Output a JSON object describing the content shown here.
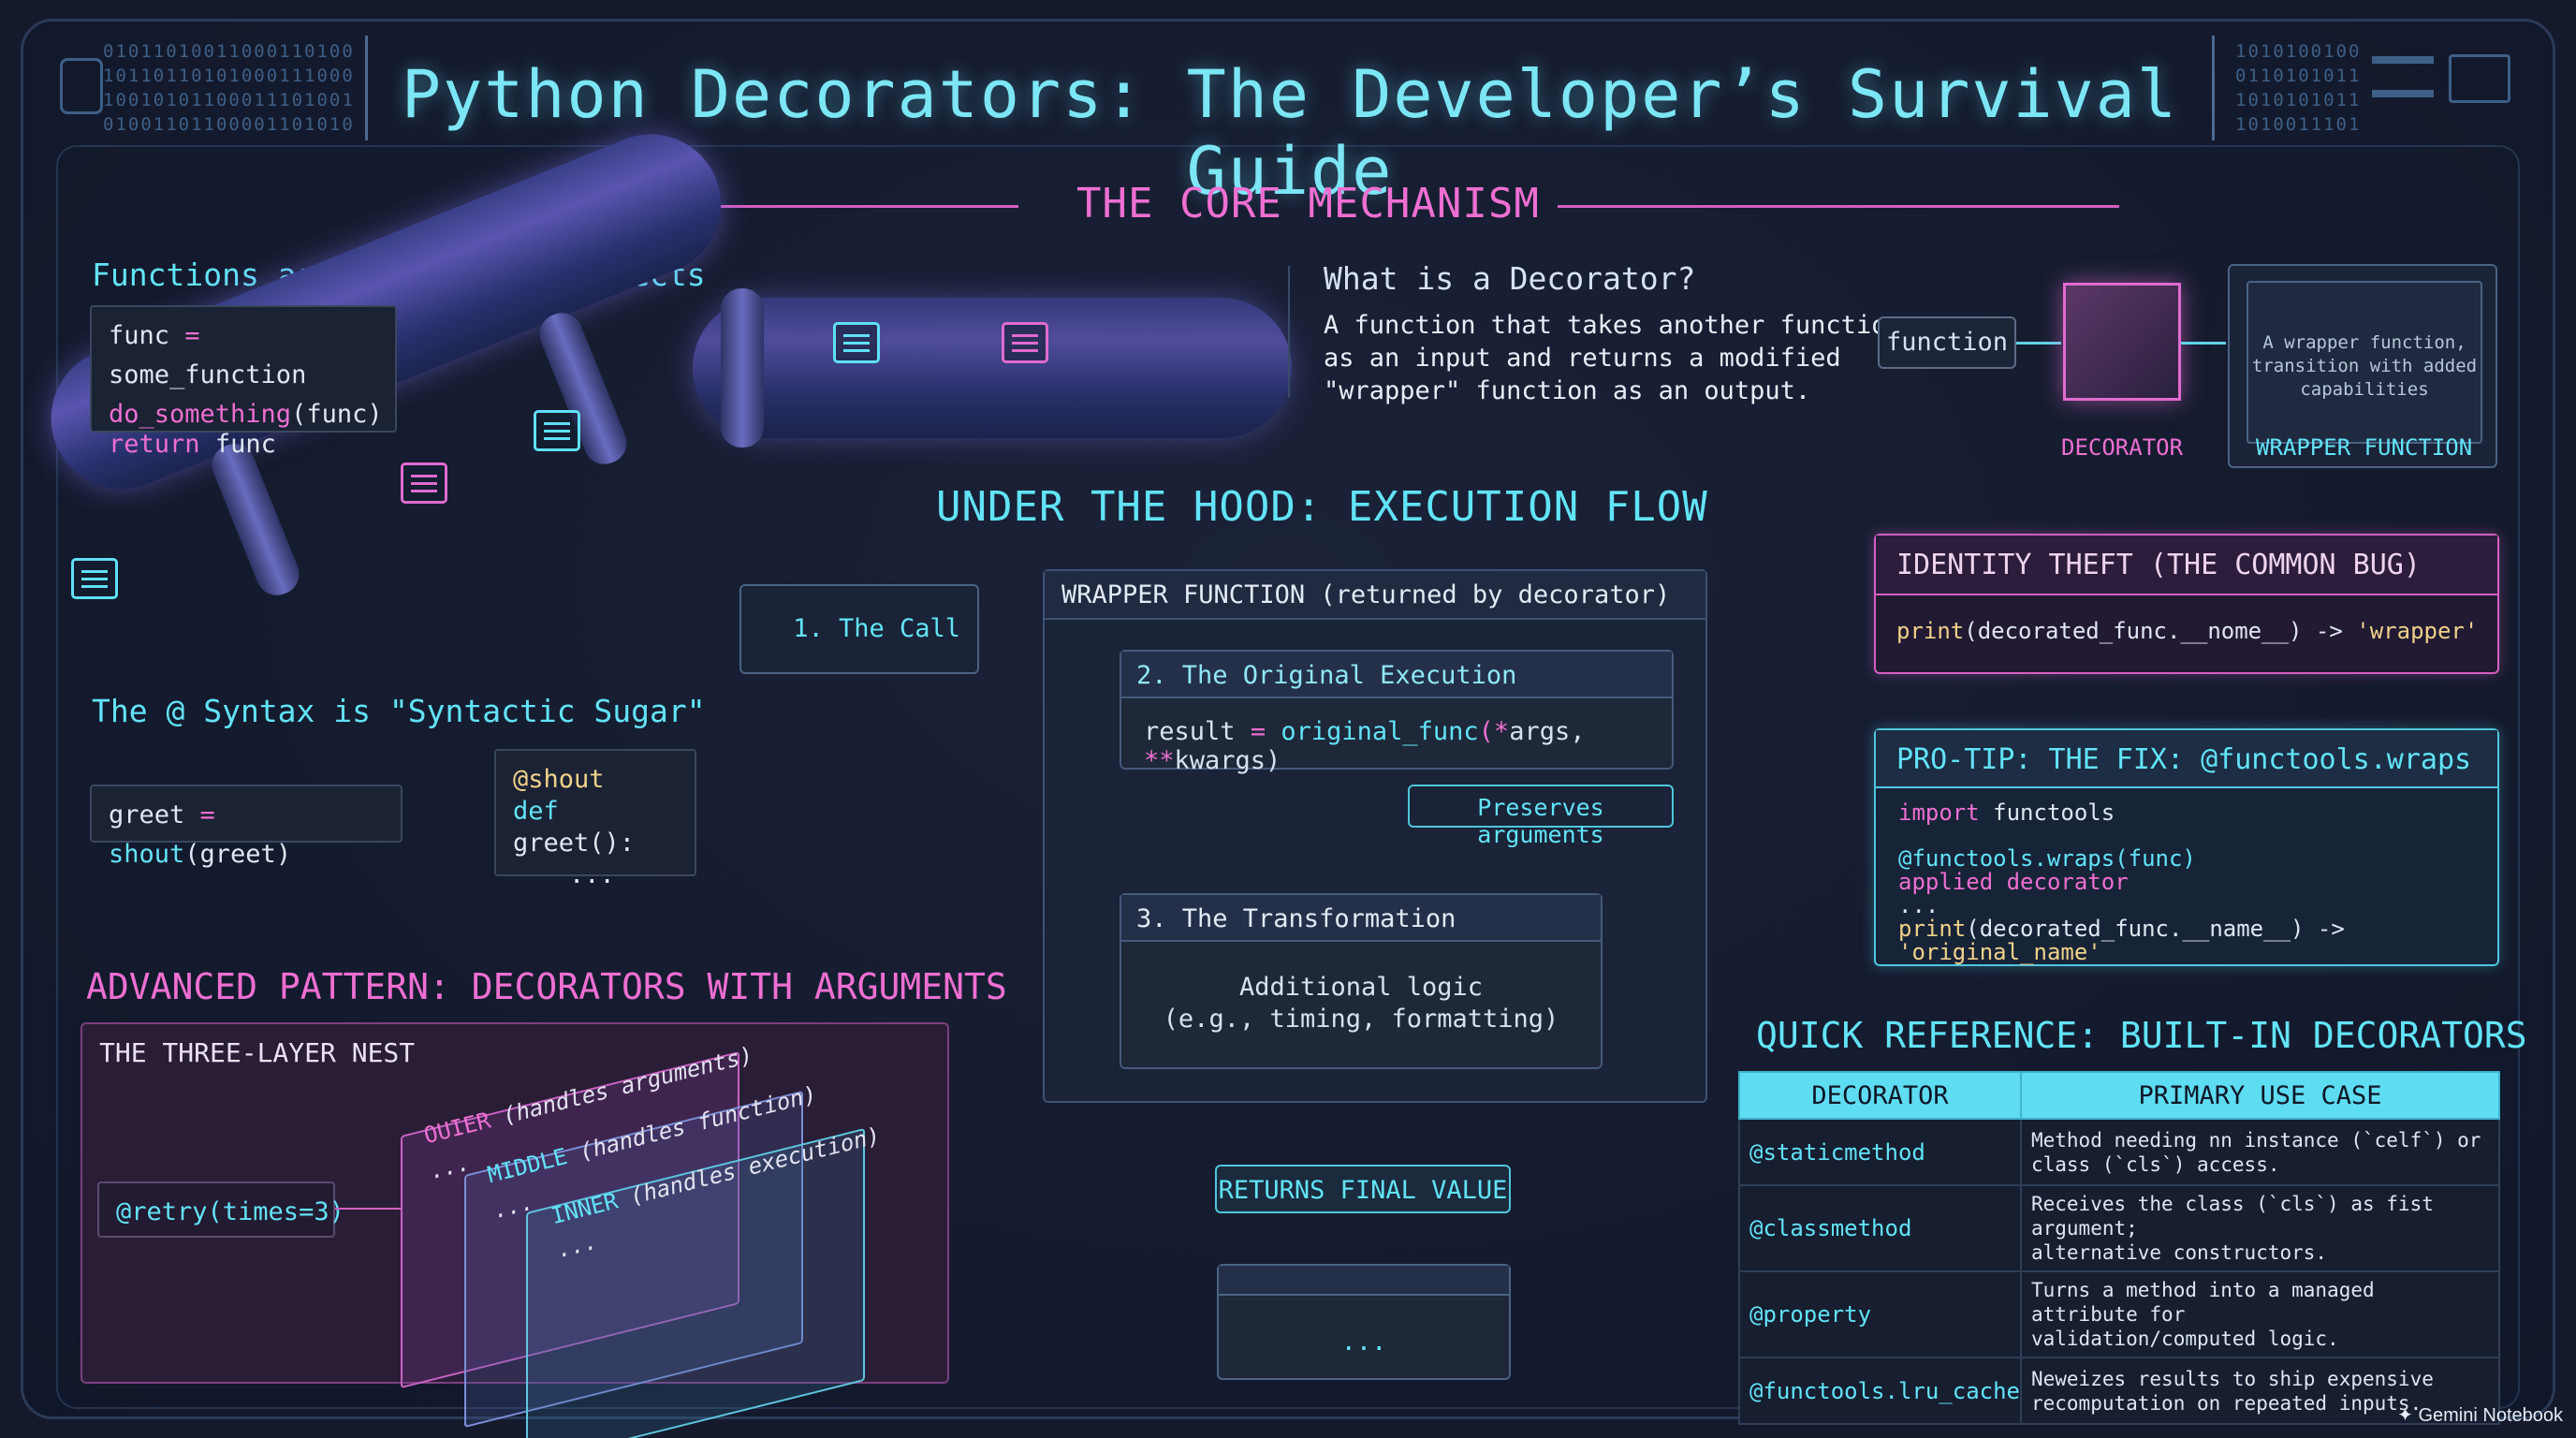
{
  "title": "Python Decorators: The Developer’s Survival Guide",
  "binary_left": [
    "01011010011000110100",
    "10110110101000111000",
    "10010101100011101001",
    "01001101100001101010"
  ],
  "binary_right": [
    "1010100100",
    "0110101011",
    "1010101011",
    "1010011101"
  ],
  "core": {
    "heading": "THE CORE MECHANISM",
    "first_class": {
      "title": "Functions are First-Class Objects",
      "line1_var": "func",
      "line1_op": "=",
      "line1_val": "some_function",
      "line2_fn": "do_something",
      "line2_args": "(func)",
      "line3_kw": "return",
      "line3_val": "func"
    },
    "what_is": {
      "title": "What is a Decorator?",
      "text_line1": "A function that takes another function",
      "text_line2": "as an input and returns a modified",
      "text_line3": "\"wrapper\" function as an output."
    },
    "diagram": {
      "input_label": "function",
      "decorator_label": "DECORATOR",
      "wrapper_label": "WRAPPER FUNCTION",
      "wrapper_line1": "A wrapper function,",
      "wrapper_line2": "transition with added",
      "wrapper_line3": "capabilities"
    }
  },
  "syntax": {
    "title": "The @ Syntax is \"Syntactic Sugar\"",
    "plain_var": "greet",
    "plain_op": "=",
    "plain_fn": "shout",
    "plain_args": "(greet)",
    "sugar_line1": "@shout",
    "sugar_line2_kw": "def",
    "sugar_line2_fn": "greet():",
    "sugar_line3": "..."
  },
  "flow": {
    "heading": "UNDER THE HOOD: EXECUTION FLOW",
    "step1": "1. The Call",
    "wrapper_title": "WRAPPER FUNCTION (returned by decorator)",
    "step2_title": "2. The Original Execution",
    "step2_var": "result",
    "step2_op": "=",
    "step2_fn": "original_func",
    "step2_args_star": "(*",
    "step2_args": "args, ",
    "step2_kwstar": "**",
    "step2_kwargs": "kwargs)",
    "preserves": "Preserves arguments",
    "step3_title": "3. The Transformation",
    "step3_line1": "Additional logic",
    "step3_line2": "(e.g., timing, formatting)",
    "returns": "RETURNS FINAL VALUE",
    "final_box": "..."
  },
  "identity": {
    "title": "IDENTITY THEFT (THE COMMON BUG)",
    "code_fn": "print",
    "code_mid": "(decorated_func.__nome__) ->",
    "code_str": "'wrapper'"
  },
  "protip": {
    "title": "PRO-TIP: THE FIX: @functools.wraps",
    "line1_kw": "import",
    "line1_val": "functools",
    "line2": "@functools.wraps(func)",
    "line3_kw": "applied",
    "line3_val": "decorator",
    "line4": "...",
    "line5_fn": "print",
    "line5_mid": "(decorated_func.__name__) ->",
    "line5_str": "'original_name'"
  },
  "advanced": {
    "heading": "ADVANCED PATTERN: DECORATORS WITH ARGUMENTS",
    "nest_title": "THE THREE-LAYER NEST",
    "call": "@retry(times=3)",
    "outer_tag": "OUIER",
    "outer_desc": "(handles arguments)",
    "middle_tag": "MIDDLE",
    "middle_desc": "(handles function)",
    "inner_tag": "INNER",
    "inner_desc": "(handles execution)",
    "ellipsis": "..."
  },
  "reference": {
    "heading": "QUICK REFERENCE: BUILT-IN DECORATORS",
    "col1": "DECORATOR",
    "col2": "PRIMARY USE CASE",
    "rows": [
      {
        "dec": "@staticmethod",
        "use1": "Method needing nn instance (`celf`) or",
        "use2": "class (`cls`) access."
      },
      {
        "dec": "@classmethod",
        "use1": "Receives the class (`cls`) as fist argument;",
        "use2": "alternative constructors."
      },
      {
        "dec": "@property",
        "use1": "Turns a method into a managed attribute for",
        "use2": "validation/computed logic."
      },
      {
        "dec": "@functools.lru_cache",
        "use1": "Neweizes results to ship expensive",
        "use2": "recomputation on repeated inputs."
      }
    ]
  },
  "footer": "Gemini Notebook",
  "colors": {
    "cyan": "#62e3f7",
    "pink": "#ee6fd2",
    "background": "#141a2c"
  }
}
